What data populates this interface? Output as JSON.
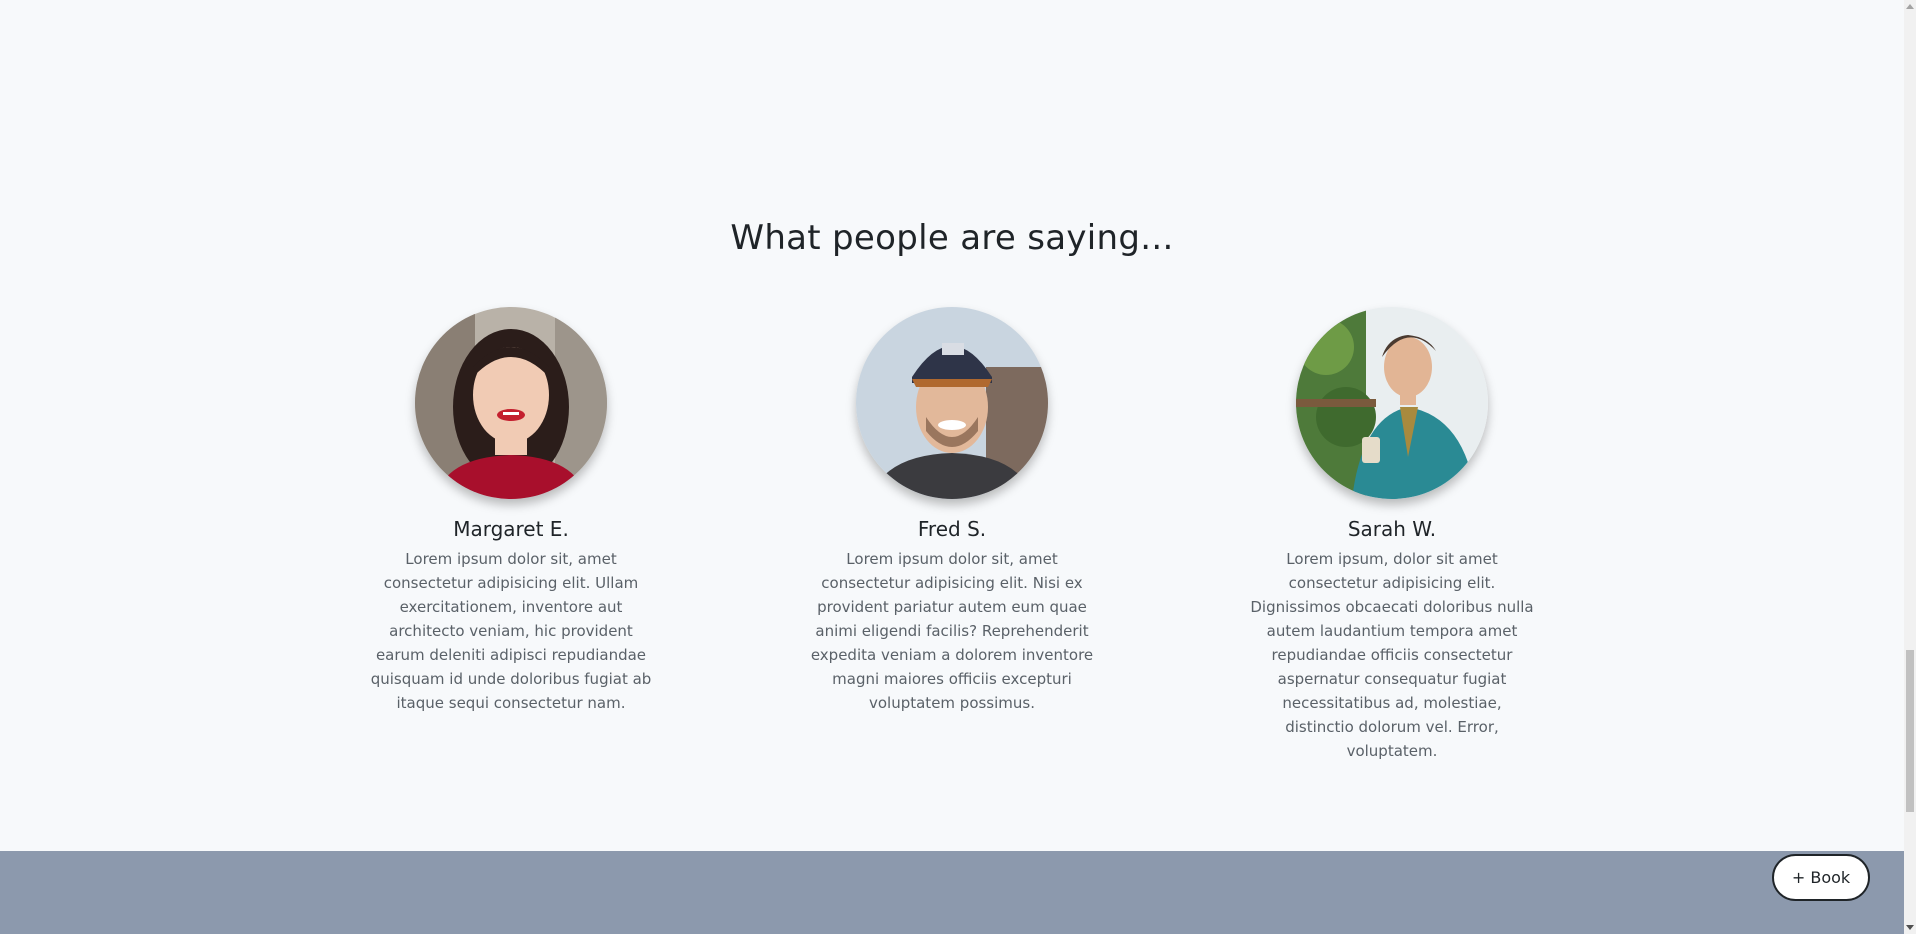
{
  "section": {
    "title": "What people are saying..."
  },
  "testimonials": [
    {
      "name": "Margaret E.",
      "quote": "Lorem ipsum dolor sit, amet consectetur adipisicing elit. Ullam exercitationem, inventore aut architecto veniam, hic provident earum deleniti adipisci repudiandae quisquam id unde doloribus fugiat ab itaque sequi consectetur nam."
    },
    {
      "name": "Fred S.",
      "quote": "Lorem ipsum dolor sit, amet consectetur adipisicing elit. Nisi ex provident pariatur autem eum quae animi eligendi facilis? Reprehenderit expedita veniam a dolorem inventore magni maiores officiis excepturi voluptatem possimus."
    },
    {
      "name": "Sarah W.",
      "quote": "Lorem ipsum, dolor sit amet consectetur adipisicing elit. Dignissimos obcaecati doloribus nulla autem laudantium tempora amet repudiandae officiis consectetur aspernatur consequatur fugiat necessitatibus ad, molestiae, distinctio dolorum vel. Error, voluptatem."
    }
  ],
  "book_button": {
    "label": "+ Book"
  },
  "colors": {
    "background": "#f7f9fb",
    "footer_band": "#8c99ad",
    "text_dark": "#1f2428",
    "text_muted": "#5a6168"
  }
}
